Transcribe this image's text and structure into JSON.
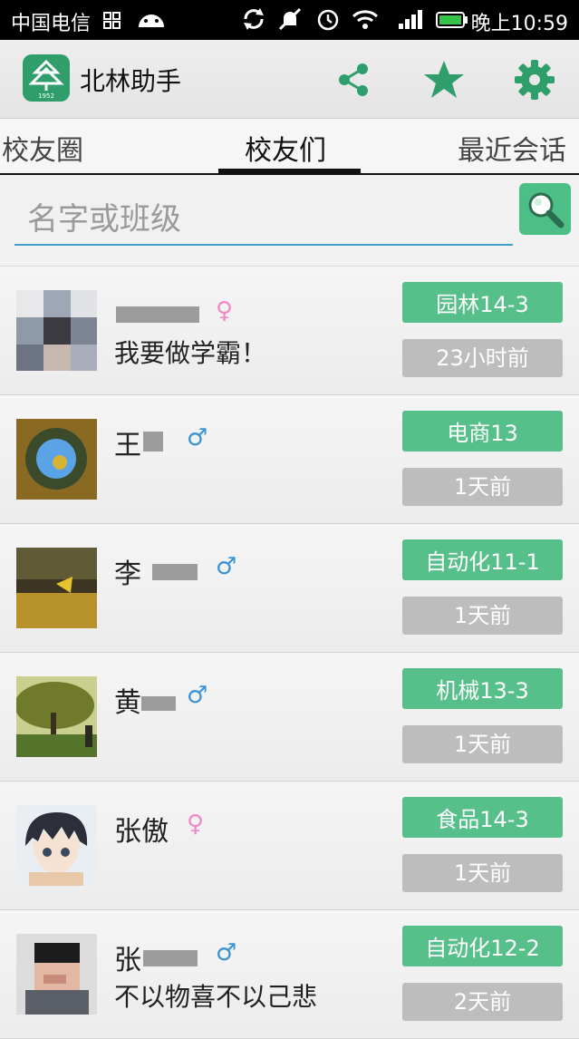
{
  "status_bar": {
    "carrier": "中国电信",
    "time": "晚上10:59",
    "icons": [
      "grid-icon",
      "android-icon",
      "sync-icon",
      "mute-icon",
      "alarm-icon",
      "wifi-icon",
      "signal-icon",
      "battery-icon"
    ]
  },
  "app_bar": {
    "title": "北林助手",
    "logo_year": "1952",
    "actions": [
      "share-icon",
      "star-icon",
      "gear-icon"
    ],
    "accent_color": "#2f9e6a"
  },
  "tabs": [
    {
      "label": "校友圈",
      "active": false
    },
    {
      "label": "校友们",
      "active": true
    },
    {
      "label": "最近会话",
      "active": false
    }
  ],
  "search": {
    "placeholder": "名字或班级",
    "value": ""
  },
  "contacts": [
    {
      "name": "",
      "gender": "female",
      "gender_symbol": "♀",
      "motto": "我要做学霸！",
      "class": "园林14-3",
      "time": "23小时前",
      "avatar": "pixelated-portrait"
    },
    {
      "name": "王",
      "gender": "male",
      "gender_symbol": "♂",
      "motto": "",
      "class": "电商13",
      "time": "1天前",
      "avatar": "tiny-planet-photo"
    },
    {
      "name": "李",
      "gender": "male",
      "gender_symbol": "♂",
      "motto": "",
      "class": "自动化11-1",
      "time": "1天前",
      "avatar": "autumn-leaves-photo"
    },
    {
      "name": "黄",
      "gender": "male",
      "gender_symbol": "♂",
      "motto": "",
      "class": "机械13-3",
      "time": "1天前",
      "avatar": "park-tree-photo"
    },
    {
      "name": "张傲",
      "gender": "female",
      "gender_symbol": "♀",
      "motto": "",
      "class": "食品14-3",
      "time": "1天前",
      "avatar": "anime-boy-drawing"
    },
    {
      "name": "张",
      "gender": "male",
      "gender_symbol": "♂",
      "motto": "不以物喜不以己悲",
      "class": "自动化12-2",
      "time": "2天前",
      "avatar": "pixelated-portrait"
    }
  ],
  "colors": {
    "class_badge": "#57c08a",
    "time_badge": "#bdbdbd",
    "male": "#3a93d6",
    "female": "#f08ac6",
    "search_underline": "#3ea0c8"
  }
}
